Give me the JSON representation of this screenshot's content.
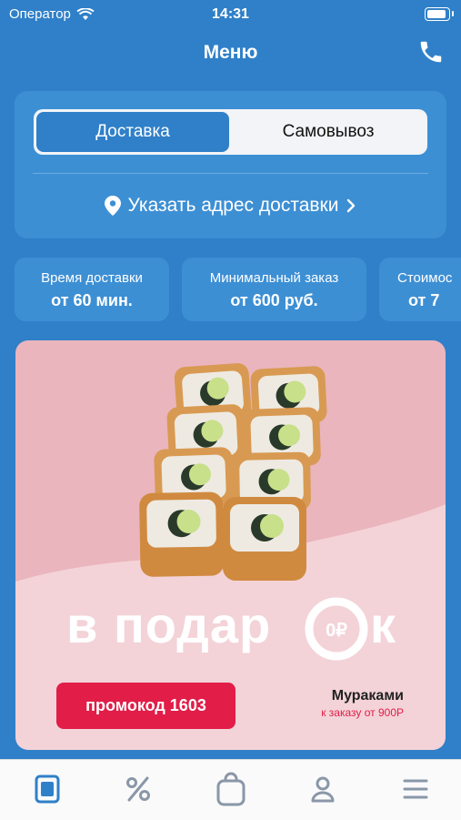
{
  "status_bar": {
    "carrier": "Оператор",
    "time": "14:31"
  },
  "nav": {
    "title": "Меню"
  },
  "delivery_toggle": {
    "options": [
      "Доставка",
      "Самовывоз"
    ],
    "selected": "Доставка"
  },
  "address": {
    "label": "Указать адрес доставки"
  },
  "info_cards": [
    {
      "label": "Время доставки",
      "value": "от 60 мин."
    },
    {
      "label": "Минимальный заказ",
      "value": "от 600 руб."
    },
    {
      "label": "Стоимос",
      "value": "от 7"
    }
  ],
  "banner": {
    "headline": "в подар",
    "headline_end": "к",
    "coin_text": "0₽",
    "promo_button": "промокод 1603",
    "brand_name": "Мураками",
    "brand_condition": "к заказу от 900Р"
  },
  "tab_bar": {
    "items": [
      "menu-icon",
      "percent-icon",
      "bag-icon",
      "profile-icon",
      "hamburger-icon"
    ],
    "active": "menu-icon"
  },
  "colors": {
    "primary": "#2f80c8",
    "card": "#3d8fd4",
    "promo": "#e11d48",
    "banner_bg": "#eab5bd"
  }
}
